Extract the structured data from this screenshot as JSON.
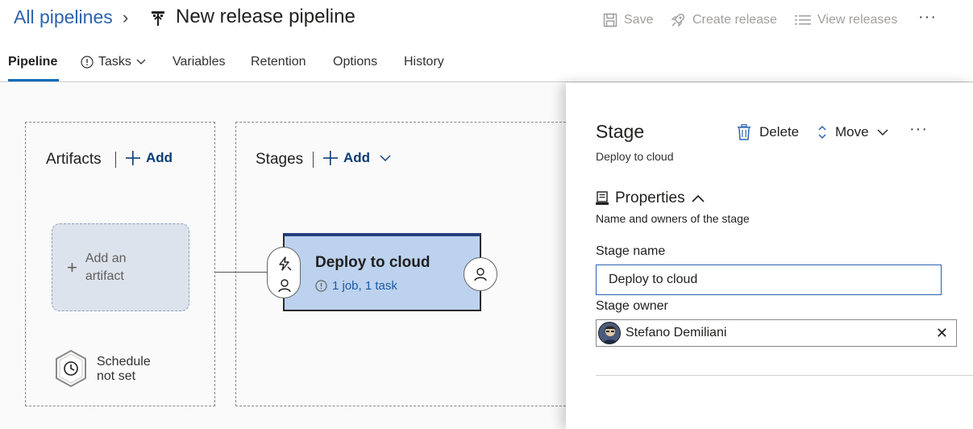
{
  "header": {
    "breadcrumb_root": "All pipelines",
    "breadcrumb_sep": "›",
    "title": "New release pipeline",
    "actions": {
      "save": "Save",
      "create_release": "Create release",
      "view_releases": "View releases",
      "more": "···"
    }
  },
  "tabs": [
    {
      "label": "Pipeline",
      "active": true
    },
    {
      "label": "Tasks",
      "icon": "info-icon",
      "has_dropdown": true
    },
    {
      "label": "Variables"
    },
    {
      "label": "Retention"
    },
    {
      "label": "Options"
    },
    {
      "label": "History"
    }
  ],
  "canvas": {
    "artifacts": {
      "title": "Artifacts",
      "add_label": "Add",
      "card_line1": "Add an",
      "card_line2": "artifact",
      "schedule_line1": "Schedule",
      "schedule_line2": "not set"
    },
    "stages": {
      "title": "Stages",
      "add_label": "Add",
      "stage_name": "Deploy to cloud",
      "stage_summary": "1 job, 1 task"
    }
  },
  "panel": {
    "title": "Stage",
    "subtitle": "Deploy to cloud",
    "delete_label": "Delete",
    "move_label": "Move",
    "more": "···",
    "properties_title": "Properties",
    "properties_sub": "Name and owners of the stage",
    "stage_name_label": "Stage name",
    "stage_name_value": "Deploy to cloud",
    "stage_owner_label": "Stage owner",
    "stage_owner_value": "Stefano Demiliani",
    "clear": "✕"
  },
  "colors": {
    "link_blue": "#2b63ad",
    "stage_fill": "#bcd2ee",
    "stage_top": "#23407e",
    "add_blue": "#0b3d73",
    "tab_underline": "#0f6cbd"
  }
}
